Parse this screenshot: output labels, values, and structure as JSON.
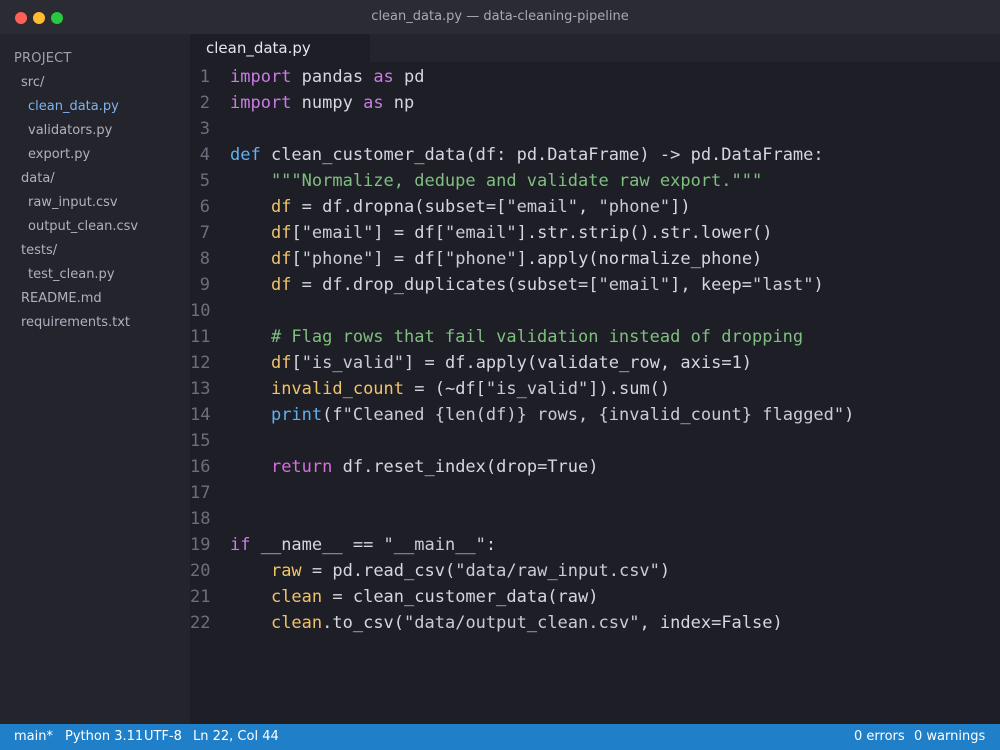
{
  "window": {
    "title": "clean_data.py — data-cleaning-pipeline"
  },
  "sidebar": {
    "header": "PROJECT",
    "items": [
      {
        "label": "src/",
        "depth": 0,
        "type": "folder"
      },
      {
        "label": "clean_data.py",
        "depth": 1,
        "type": "file",
        "active": true
      },
      {
        "label": "validators.py",
        "depth": 1,
        "type": "file"
      },
      {
        "label": "export.py",
        "depth": 1,
        "type": "file"
      },
      {
        "label": "data/",
        "depth": 0,
        "type": "folder"
      },
      {
        "label": "raw_input.csv",
        "depth": 1,
        "type": "file"
      },
      {
        "label": "output_clean.csv",
        "depth": 1,
        "type": "file"
      },
      {
        "label": "tests/",
        "depth": 0,
        "type": "folder"
      },
      {
        "label": "test_clean.py",
        "depth": 1,
        "type": "file"
      },
      {
        "label": "README.md",
        "depth": 0,
        "type": "file"
      },
      {
        "label": "requirements.txt",
        "depth": 0,
        "type": "file"
      }
    ]
  },
  "tabs": [
    {
      "label": "clean_data.py",
      "active": true
    }
  ],
  "code": {
    "lines": [
      {
        "n": "1",
        "t": "import pandas as pd"
      },
      {
        "n": "2",
        "t": "import numpy as np"
      },
      {
        "n": "3",
        "t": ""
      },
      {
        "n": "4",
        "t": "def clean_customer_data(df: pd.DataFrame) -> pd.DataFrame:"
      },
      {
        "n": "5",
        "t": "    \"\"\"Normalize, dedupe and validate raw export.\"\"\""
      },
      {
        "n": "6",
        "t": "    df = df.dropna(subset=[\"email\", \"phone\"])"
      },
      {
        "n": "7",
        "t": "    df[\"email\"] = df[\"email\"].str.strip().str.lower()"
      },
      {
        "n": "8",
        "t": "    df[\"phone\"] = df[\"phone\"].apply(normalize_phone)"
      },
      {
        "n": "9",
        "t": "    df = df.drop_duplicates(subset=[\"email\"], keep=\"last\")"
      },
      {
        "n": "10",
        "t": ""
      },
      {
        "n": "11",
        "t": "    # Flag rows that fail validation instead of dropping"
      },
      {
        "n": "12",
        "t": "    df[\"is_valid\"] = df.apply(validate_row, axis=1)"
      },
      {
        "n": "13",
        "t": "    invalid_count = (~df[\"is_valid\"]).sum()"
      },
      {
        "n": "14",
        "t": "    print(f\"Cleaned {len(df)} rows, {invalid_count} flagged\")"
      },
      {
        "n": "15",
        "t": ""
      },
      {
        "n": "16",
        "t": "    return df.reset_index(drop=True)"
      },
      {
        "n": "17",
        "t": ""
      },
      {
        "n": "18",
        "t": ""
      },
      {
        "n": "19",
        "t": "if __name__ == \"__main__\":"
      },
      {
        "n": "20",
        "t": "    raw = pd.read_csv(\"data/raw_input.csv\")"
      },
      {
        "n": "21",
        "t": "    clean = clean_customer_data(raw)"
      },
      {
        "n": "22",
        "t": "    clean.to_csv(\"data/output_clean.csv\", index=False)"
      }
    ]
  },
  "statusbar": {
    "branch": "main*",
    "language": "Python 3.11",
    "encoding": "UTF-8",
    "cursor": "Ln 22, Col 44",
    "errors": "0 errors",
    "warnings": "0 warnings"
  },
  "colors": {
    "accent": "#1f7fc9",
    "keyword": "#c97ce4",
    "definition": "#60b0f0",
    "variable": "#f0c36a",
    "comment": "#7fbf7f"
  }
}
